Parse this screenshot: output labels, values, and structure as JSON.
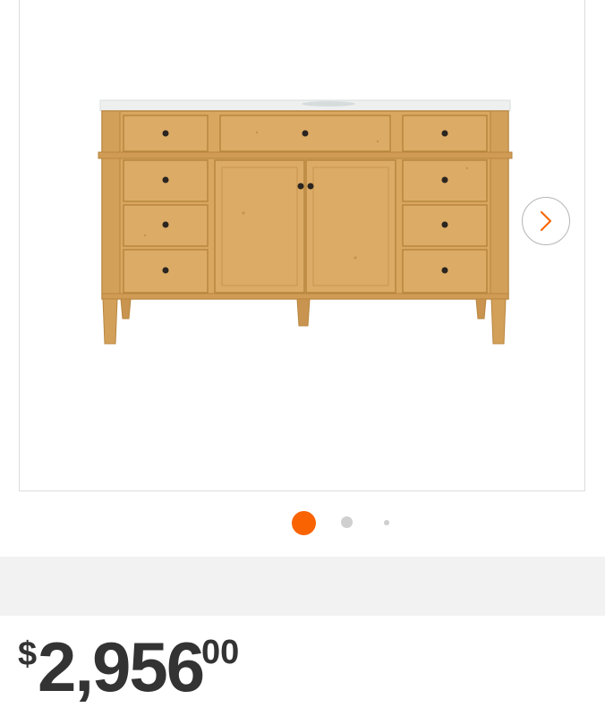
{
  "product_gallery": {
    "image": {
      "name": "bathroom-vanity-cabinet",
      "wood_color": "#d9a75f",
      "counter_color": "#eef0f0",
      "hardware_color": "#2a2520"
    },
    "next_button": {
      "icon": "chevron-right-icon",
      "color": "#f96302"
    },
    "pagination": {
      "count": 3,
      "active_index": 0,
      "active_color": "#f96302",
      "inactive_color": "#cfcfcf"
    }
  },
  "price": {
    "currency_symbol": "$",
    "whole": "2,956",
    "cents": "00"
  }
}
